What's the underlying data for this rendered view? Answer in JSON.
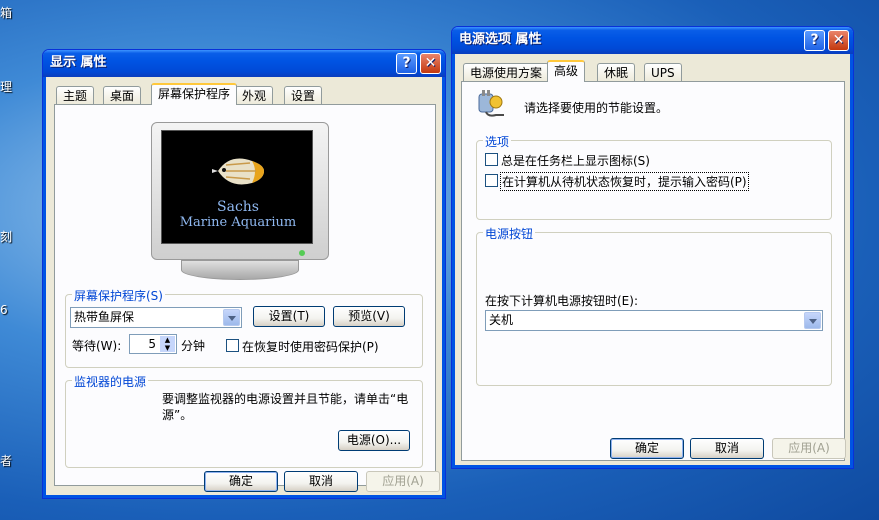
{
  "desktop": {
    "edge_labels": [
      "箱",
      "理",
      "刻",
      "6",
      "者"
    ]
  },
  "display_props": {
    "title": "显示 属性",
    "tabs": [
      "主题",
      "桌面",
      "屏幕保护程序",
      "外观",
      "设置"
    ],
    "active_tab": "屏幕保护程序",
    "preview_text_line1": "Sachs",
    "preview_text_line2": "Marine Aquarium",
    "screensaver_group": "屏幕保护程序(S)",
    "screensaver_selected": "热带鱼屏保",
    "settings_button": "设置(T)",
    "preview_button": "预览(V)",
    "wait_label": "等待(W):",
    "wait_value": "5",
    "wait_unit": "分钟",
    "password_check": "在恢复时使用密码保护(P)",
    "monitor_power_group": "监视器的电源",
    "monitor_power_text": "要调整监视器的电源设置并且节能，请单击“电源”。",
    "power_button": "电源(O)...",
    "ok": "确定",
    "cancel": "取消",
    "apply": "应用(A)"
  },
  "power_options": {
    "title": "电源选项 属性",
    "tabs": [
      "电源使用方案",
      "高级",
      "休眠",
      "UPS"
    ],
    "active_tab": "高级",
    "intro_text": "请选择要使用的节能设置。",
    "options_group": "选项",
    "option_tray_icon": "总是在任务栏上显示图标(S)",
    "option_password": "在计算机从待机状态恢复时，提示输入密码(P)",
    "power_buttons_group": "电源按钮",
    "power_button_label": "在按下计算机电源按钮时(E):",
    "power_button_action": "关机",
    "ok": "确定",
    "cancel": "取消",
    "apply": "应用(A)"
  }
}
